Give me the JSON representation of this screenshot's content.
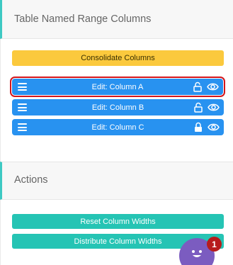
{
  "section1": {
    "title": "Table Named Range Columns",
    "consolidate_label": "Consolidate Columns",
    "columns": [
      {
        "label": "Edit: Column A",
        "locked": false,
        "visible": true,
        "selected": true
      },
      {
        "label": "Edit: Column B",
        "locked": false,
        "visible": true,
        "selected": false
      },
      {
        "label": "Edit: Column C",
        "locked": true,
        "visible": true,
        "selected": false
      }
    ]
  },
  "section2": {
    "title": "Actions",
    "reset_label": "Reset Column Widths",
    "distribute_label": "Distribute Column Widths"
  },
  "chat": {
    "badge_count": "1"
  },
  "colors": {
    "accent": "#3ec9c3",
    "column_button": "#2892f0",
    "consolidate_button": "#fbc93d",
    "action_button": "#25c4b4",
    "selected_outline": "#d3151b",
    "chat_bubble": "#7b5cc0",
    "badge": "#b71c1c"
  }
}
